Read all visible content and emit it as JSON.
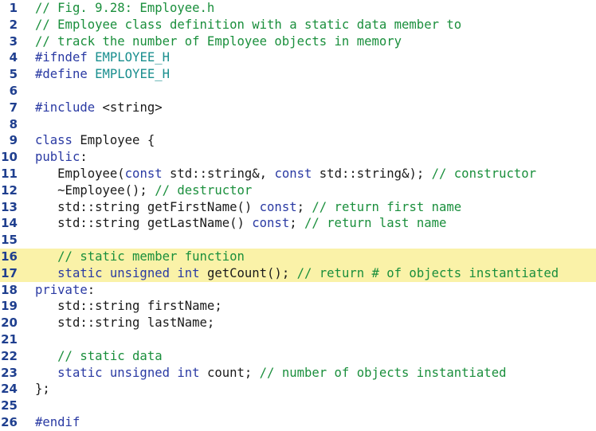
{
  "colors": {
    "comment": "#1a8f3c",
    "keyword": "#2a3aa3",
    "preprocessor_symbol": "#1a8f8f",
    "text": "#1a1a1a",
    "line_number": "#1f3f8f",
    "highlight": "#faf2a8"
  },
  "lines": [
    {
      "num": "1",
      "hl": false,
      "segs": [
        {
          "t": "// Fig. 9.28: Employee.h",
          "c": "c"
        }
      ]
    },
    {
      "num": "2",
      "hl": false,
      "segs": [
        {
          "t": "// Employee class definition with a static data member to",
          "c": "c"
        }
      ]
    },
    {
      "num": "3",
      "hl": false,
      "segs": [
        {
          "t": "// track the number of Employee objects in memory",
          "c": "c"
        }
      ]
    },
    {
      "num": "4",
      "hl": false,
      "segs": [
        {
          "t": "#ifndef ",
          "c": "k"
        },
        {
          "t": "EMPLOYEE_H",
          "c": "p"
        }
      ]
    },
    {
      "num": "5",
      "hl": false,
      "segs": [
        {
          "t": "#define ",
          "c": "k"
        },
        {
          "t": "EMPLOYEE_H",
          "c": "p"
        }
      ]
    },
    {
      "num": "6",
      "hl": false,
      "segs": []
    },
    {
      "num": "7",
      "hl": false,
      "segs": [
        {
          "t": "#include ",
          "c": "k"
        },
        {
          "t": "<string>",
          "c": "t"
        }
      ]
    },
    {
      "num": "8",
      "hl": false,
      "segs": []
    },
    {
      "num": "9",
      "hl": false,
      "segs": [
        {
          "t": "class ",
          "c": "k"
        },
        {
          "t": "Employee {",
          "c": "t"
        }
      ]
    },
    {
      "num": "10",
      "hl": false,
      "segs": [
        {
          "t": "public",
          "c": "k"
        },
        {
          "t": ":",
          "c": "t"
        }
      ]
    },
    {
      "num": "11",
      "hl": false,
      "segs": [
        {
          "t": "   Employee(",
          "c": "t"
        },
        {
          "t": "const ",
          "c": "k"
        },
        {
          "t": "std::string&, ",
          "c": "t"
        },
        {
          "t": "const ",
          "c": "k"
        },
        {
          "t": "std::string&); ",
          "c": "t"
        },
        {
          "t": "// constructor",
          "c": "c"
        }
      ]
    },
    {
      "num": "12",
      "hl": false,
      "segs": [
        {
          "t": "   ~Employee(); ",
          "c": "t"
        },
        {
          "t": "// destructor",
          "c": "c"
        }
      ]
    },
    {
      "num": "13",
      "hl": false,
      "segs": [
        {
          "t": "   std::string getFirstName() ",
          "c": "t"
        },
        {
          "t": "const",
          "c": "k"
        },
        {
          "t": "; ",
          "c": "t"
        },
        {
          "t": "// return first name",
          "c": "c"
        }
      ]
    },
    {
      "num": "14",
      "hl": false,
      "segs": [
        {
          "t": "   std::string getLastName() ",
          "c": "t"
        },
        {
          "t": "const",
          "c": "k"
        },
        {
          "t": "; ",
          "c": "t"
        },
        {
          "t": "// return last name",
          "c": "c"
        }
      ]
    },
    {
      "num": "15",
      "hl": false,
      "segs": []
    },
    {
      "num": "16",
      "hl": true,
      "segs": [
        {
          "t": "   // static member function",
          "c": "c"
        }
      ]
    },
    {
      "num": "17",
      "hl": true,
      "segs": [
        {
          "t": "   static unsigned int ",
          "c": "k"
        },
        {
          "t": "getCount(); ",
          "c": "t"
        },
        {
          "t": "// return # of objects instantiated",
          "c": "c"
        }
      ]
    },
    {
      "num": "18",
      "hl": false,
      "segs": [
        {
          "t": "private",
          "c": "k"
        },
        {
          "t": ":",
          "c": "t"
        }
      ]
    },
    {
      "num": "19",
      "hl": false,
      "segs": [
        {
          "t": "   std::string firstName;",
          "c": "t"
        }
      ]
    },
    {
      "num": "20",
      "hl": false,
      "segs": [
        {
          "t": "   std::string lastName;",
          "c": "t"
        }
      ]
    },
    {
      "num": "21",
      "hl": false,
      "segs": []
    },
    {
      "num": "22",
      "hl": false,
      "segs": [
        {
          "t": "   // static data",
          "c": "c"
        }
      ]
    },
    {
      "num": "23",
      "hl": false,
      "segs": [
        {
          "t": "   static unsigned int ",
          "c": "k"
        },
        {
          "t": "count; ",
          "c": "t"
        },
        {
          "t": "// number of objects instantiated",
          "c": "c"
        }
      ]
    },
    {
      "num": "24",
      "hl": false,
      "segs": [
        {
          "t": "};",
          "c": "t"
        }
      ]
    },
    {
      "num": "25",
      "hl": false,
      "segs": []
    },
    {
      "num": "26",
      "hl": false,
      "segs": [
        {
          "t": "#endif",
          "c": "k"
        }
      ]
    }
  ]
}
